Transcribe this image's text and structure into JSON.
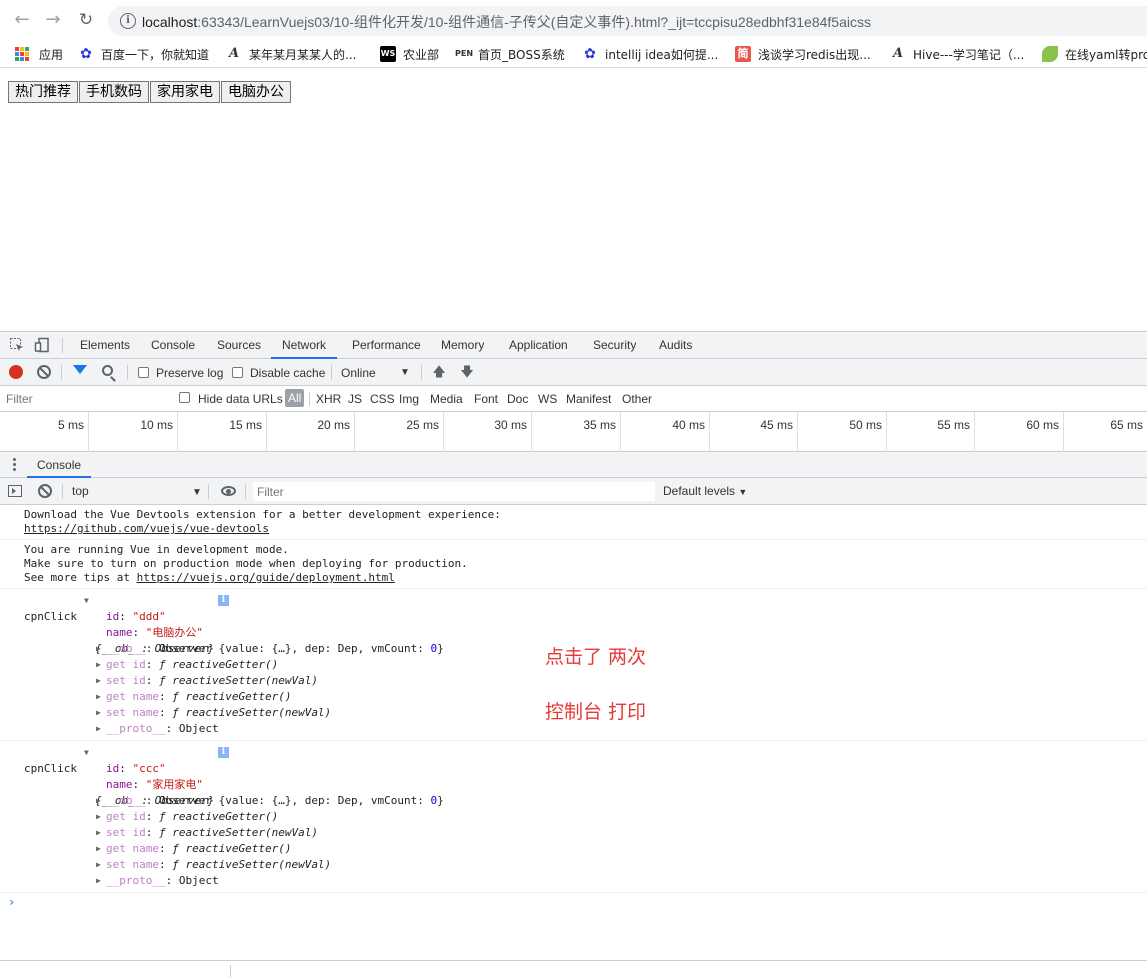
{
  "browser": {
    "url_host": "localhost",
    "url_path": ":63343/LearnVuejs03/10-组件化开发/10-组件通信-子传父(自定义事件).html?_ijt=tccpisu28edbhf31e84f5aicss",
    "bookmarks": [
      {
        "label": "应用",
        "icon": "apps-grid-icon"
      },
      {
        "label": "百度一下，你就知道",
        "icon": "baidu-paw-icon",
        "color": "#2932e1"
      },
      {
        "label": "某年某月某某人的...",
        "icon": "script-a-icon",
        "color": "#333333"
      },
      {
        "label": "农业部",
        "icon": "ws-icon",
        "color": "#000000"
      },
      {
        "label": "首页_BOSS系统",
        "icon": "pen-icon",
        "color": "#333333"
      },
      {
        "label": "intellij idea如何提...",
        "icon": "baidu-paw-icon",
        "color": "#2932e1"
      },
      {
        "label": "浅谈学习redis出现...",
        "icon": "jian-icon",
        "color": "#e8574f"
      },
      {
        "label": "Hive---学习笔记（...",
        "icon": "script-a-icon",
        "color": "#333333"
      },
      {
        "label": "在线yaml转pro",
        "icon": "leaf-icon",
        "color": "#8bc34a"
      }
    ]
  },
  "page": {
    "buttons": [
      "热门推荐",
      "手机数码",
      "家用家电",
      "电脑办公"
    ]
  },
  "devtools": {
    "tabs": [
      "Elements",
      "Console",
      "Sources",
      "Network",
      "Performance",
      "Memory",
      "Application",
      "Security",
      "Audits"
    ],
    "active_tab": "Network",
    "network_toolbar": {
      "preserve_log": "Preserve log",
      "disable_cache": "Disable cache",
      "throttle": "Online"
    },
    "filter_row": {
      "placeholder": "Filter",
      "hide_data_urls": "Hide data URLs",
      "types": [
        "All",
        "XHR",
        "JS",
        "CSS",
        "Img",
        "Media",
        "Font",
        "Doc",
        "WS",
        "Manifest",
        "Other"
      ]
    },
    "timeline_ticks": [
      "5 ms",
      "10 ms",
      "15 ms",
      "20 ms",
      "25 ms",
      "30 ms",
      "35 ms",
      "40 ms",
      "45 ms",
      "50 ms",
      "55 ms",
      "60 ms",
      "65 ms"
    ],
    "drawer_tab": "Console",
    "console_toolbar": {
      "context": "top",
      "filter_placeholder": "Filter",
      "levels": "Default levels"
    },
    "console": {
      "msg1_line1": "Download the Vue Devtools extension for a better development experience:",
      "msg1_link": "https://github.com/vuejs/vue-devtools",
      "msg2_line1": "You are running Vue in development mode.",
      "msg2_line2": "Make sure to turn on production mode when deploying for production.",
      "msg2_line3_prefix": "See more tips at ",
      "msg2_link": "https://vuejs.org/guide/deployment.html",
      "logs": [
        {
          "label": "cpnClick",
          "summary": "{__ob__: Observer}",
          "id": "\"ddd\"",
          "name": "\"电脑办公\""
        },
        {
          "label": "cpnClick",
          "summary": "{__ob__: Observer}",
          "id": "\"ccc\"",
          "name": "\"家用家电\""
        }
      ],
      "ob_key": "__ob__",
      "ob_value": "Observer {value: {…}, dep: Dep, vmCount: ",
      "ob_count": "0",
      "ob_close": "}",
      "getter_fn": "reactiveGetter()",
      "setter_fn": "reactiveSetter(newVal)",
      "get_id": "get id",
      "set_id": "set id",
      "get_name": "get name",
      "set_name": "set name",
      "proto_key": "__proto__",
      "proto_value": "Object",
      "id_key": "id",
      "name_key": "name",
      "f_glyph": "ƒ",
      "prompt": "›"
    },
    "annotations": [
      "点击了 两次",
      "控制台 打印"
    ]
  }
}
